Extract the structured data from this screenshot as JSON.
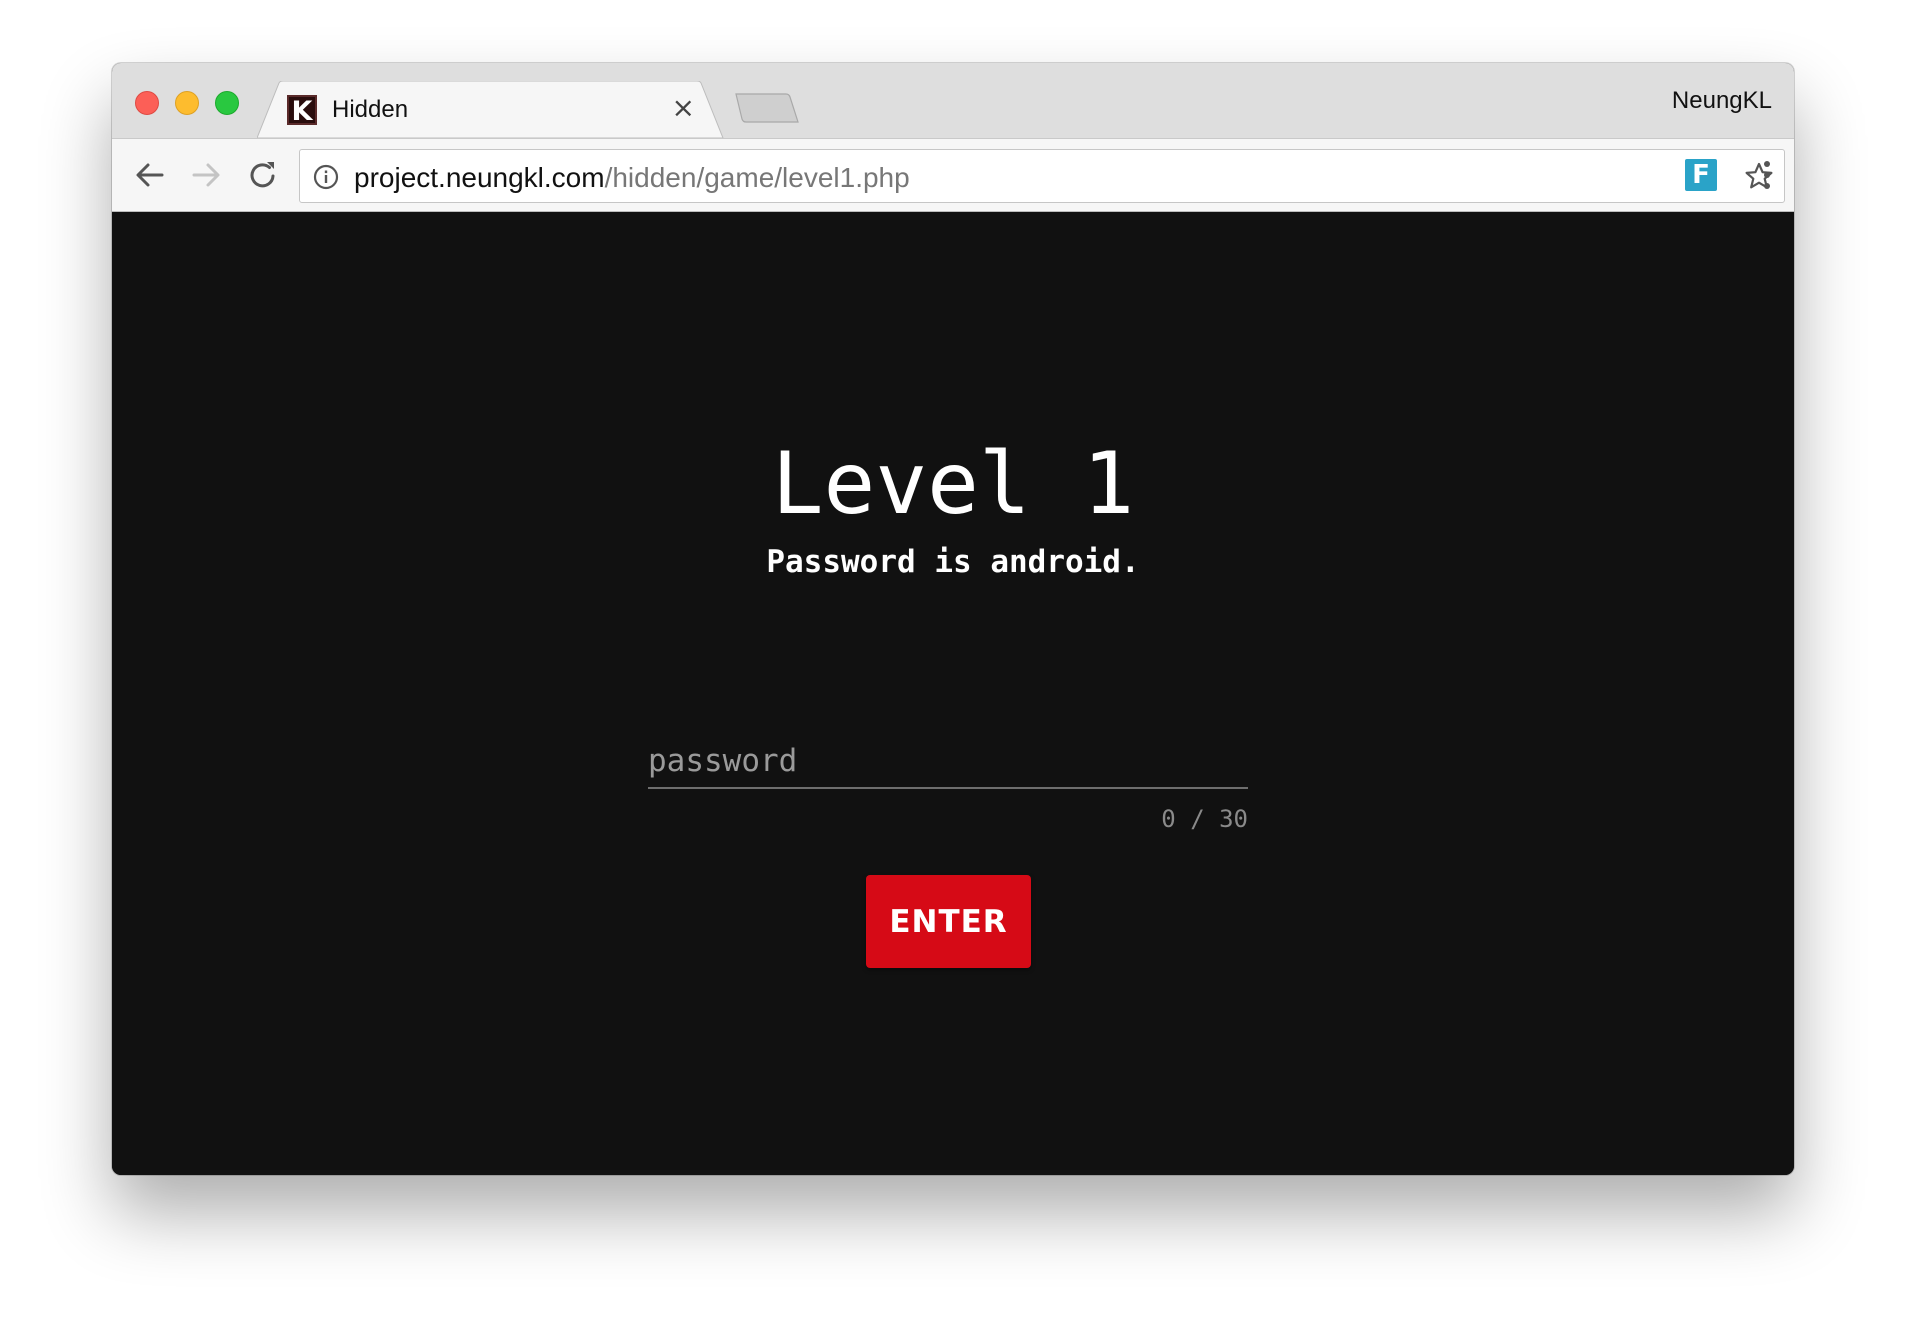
{
  "browser": {
    "tab": {
      "title": "Hidden",
      "favicon_letter": "K",
      "close_glyph": "×"
    },
    "profile_name": "NeungKL",
    "url": {
      "host": "project.neungkl.com",
      "path": "/hidden/game/level1.php"
    },
    "extension_letter": "F"
  },
  "page": {
    "title": "Level 1",
    "hint": "Password is android.",
    "password_input": {
      "value": "",
      "placeholder": "password"
    },
    "char_counter": "0 / 30",
    "enter_label": "ENTER"
  },
  "colors": {
    "page_background": "#111111",
    "button_background": "#d60a16",
    "text": "#ffffff"
  }
}
